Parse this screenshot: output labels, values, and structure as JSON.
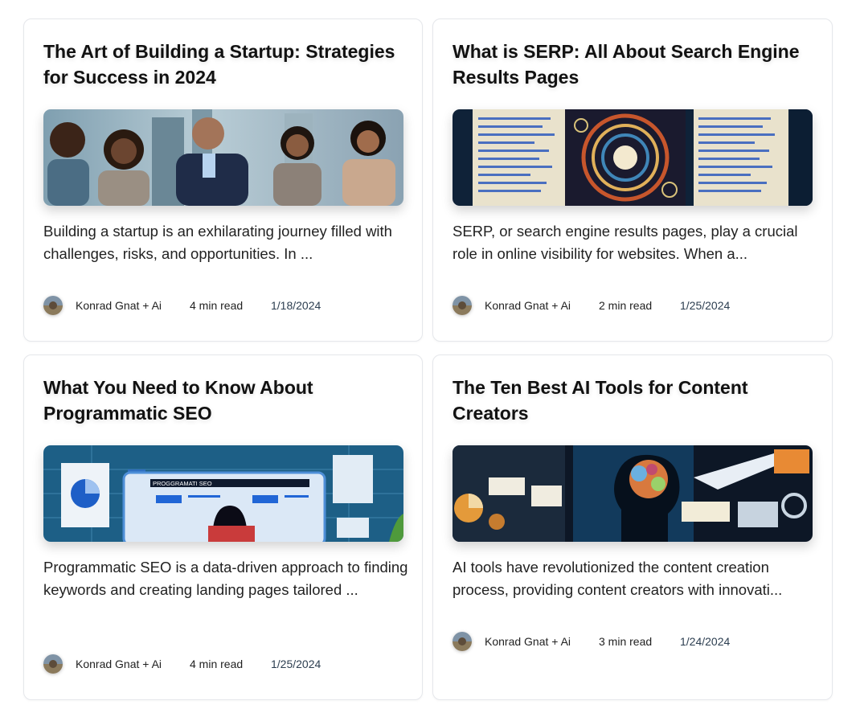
{
  "posts": [
    {
      "title": "The Art of Building a Startup: Strategies for Success in 2024",
      "excerpt": "Building a startup is an exhilarating journey filled with challenges, risks, and opportunities. In ...",
      "author": "Konrad Gnat + Ai",
      "read_time": "4 min read",
      "date": "1/18/2024",
      "image": "startup-team-illustration"
    },
    {
      "title": "What is SERP: All About Search Engine Results Pages",
      "excerpt": "SERP, or search engine results pages, play a crucial role in online visibility for websites. When a...",
      "author": "Konrad Gnat + Ai",
      "read_time": "2 min read",
      "date": "1/25/2024",
      "image": "serp-abstract-illustration"
    },
    {
      "title": "What You Need to Know About Programmatic SEO",
      "excerpt": "Programmatic SEO is a data-driven approach to finding keywords and creating landing pages tailored ...",
      "author": "Konrad Gnat + Ai",
      "read_time": "4 min read",
      "date": "1/25/2024",
      "image": "programmatic-seo-illustration",
      "image_caption": "PROGGRAMATI SEO"
    },
    {
      "title": "The Ten Best AI Tools for Content Creators",
      "excerpt": "AI tools have revolutionized the content creation process, providing content creators with innovati...",
      "author": "Konrad Gnat + Ai",
      "read_time": "3 min read",
      "date": "1/24/2024",
      "image": "ai-tools-illustration"
    }
  ],
  "colors": {
    "card_border": "#e5e7eb",
    "text": "#111111",
    "date": "#2c3e50"
  }
}
